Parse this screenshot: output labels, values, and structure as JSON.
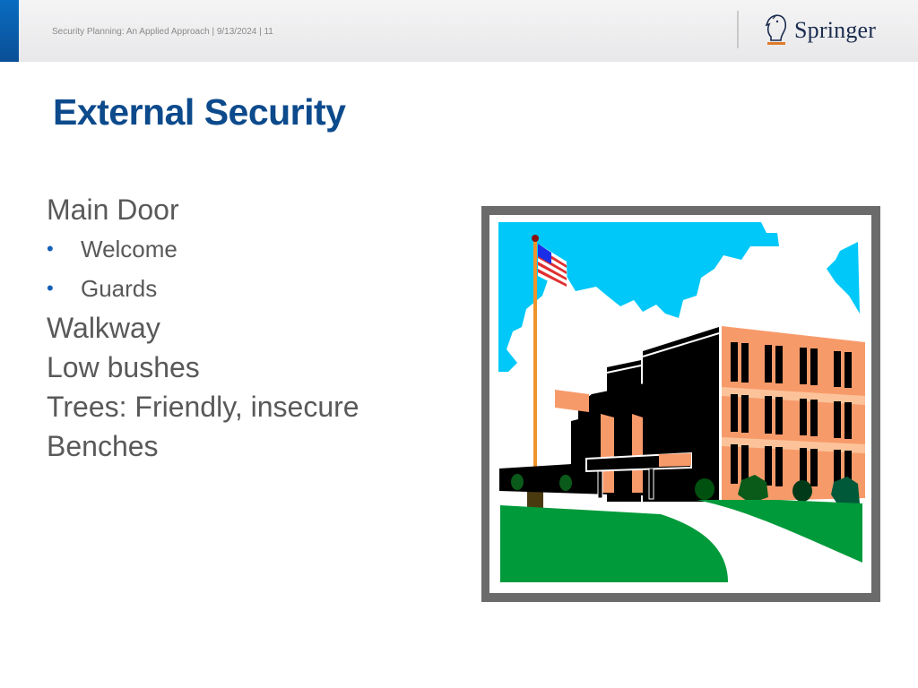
{
  "header": {
    "footer_text": "Security Planning: An Applied Approach | 9/13/2024 | 11",
    "logo_text": "Springer",
    "logo_icon": "knight-chess-horse-icon",
    "accent_color": "#0a5ca8"
  },
  "slide": {
    "title": "External Security",
    "content": [
      {
        "level": 1,
        "text": "Main Door"
      },
      {
        "level": 2,
        "text": "Welcome"
      },
      {
        "level": 2,
        "text": "Guards"
      },
      {
        "level": 1,
        "text": "Walkway"
      },
      {
        "level": 1,
        "text": "Low bushes"
      },
      {
        "level": 1,
        "text": "Trees: Friendly, insecure"
      },
      {
        "level": 1,
        "text": "Benches"
      }
    ],
    "bullet_glyph": "•",
    "picture": {
      "description": "Clip art of a school building with flagpole, American flag, clouds, bushes, lawn and walkway",
      "colors": {
        "sky": "#00c8f8",
        "brick": "#f79a6a",
        "building": "#000000",
        "grass": "#009a3a",
        "frame": "#6b6b6b"
      }
    }
  }
}
